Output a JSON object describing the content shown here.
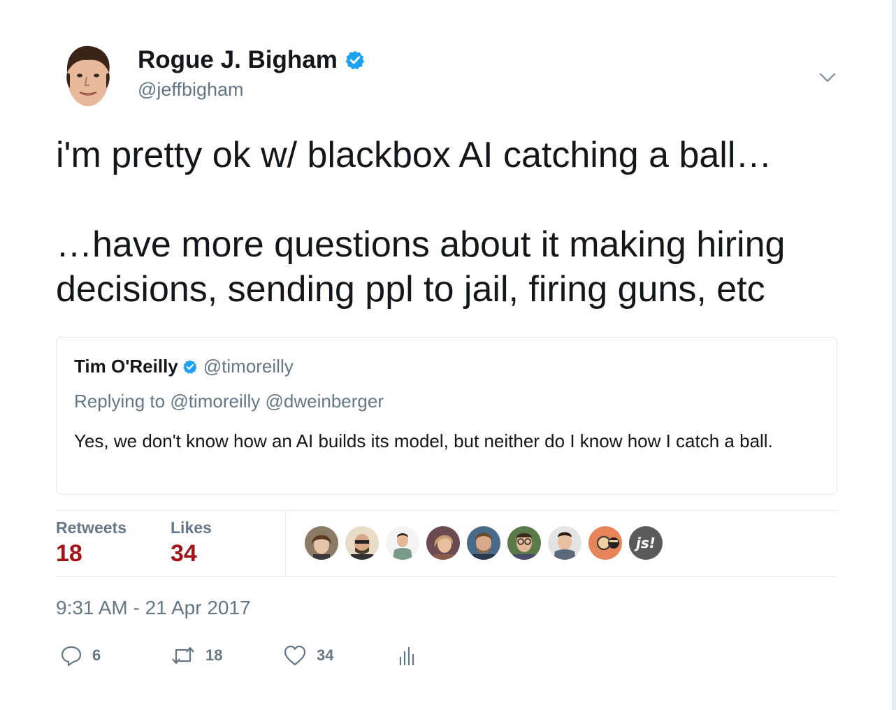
{
  "author": {
    "name": "Rogue J. Bigham",
    "handle": "@jeffbigham"
  },
  "tweet": {
    "line1": "i'm pretty ok w/ blackbox AI catching a ball…",
    "line2": "…have more questions about it making hiring",
    "line3": "decisions, sending ppl to jail, firing guns, etc"
  },
  "quoted": {
    "name": "Tim O'Reilly",
    "handle": "@timoreilly",
    "reply_prefix": "Replying to",
    "reply_to": "@timoreilly @dweinberger",
    "text": "Yes, we don't know how an AI builds its model, but neither do I know how I catch a ball."
  },
  "stats": {
    "retweets_label": "Retweets",
    "retweets_value": "18",
    "likes_label": "Likes",
    "likes_value": "34"
  },
  "liker_avatars": [
    {
      "name": "liker-1",
      "bg": "#8a7a66"
    },
    {
      "name": "liker-2",
      "bg": "#c9a98a"
    },
    {
      "name": "liker-3",
      "bg": "#f2f2f2"
    },
    {
      "name": "liker-4",
      "bg": "#6b4a52"
    },
    {
      "name": "liker-5",
      "bg": "#4a6a8a"
    },
    {
      "name": "liker-6",
      "bg": "#5a7a4a"
    },
    {
      "name": "liker-7",
      "bg": "#e0e0e0"
    },
    {
      "name": "liker-8",
      "bg": "#e8845a"
    },
    {
      "name": "liker-9",
      "bg": "#5a5a5a",
      "text": "js!"
    }
  ],
  "timestamp": "9:31 AM - 21 Apr 2017",
  "actions": {
    "replies": "6",
    "retweets": "18",
    "likes": "34"
  },
  "colors": {
    "verified": "#1da1f2",
    "stat_value": "#a0141a",
    "muted": "#657786"
  },
  "icons": [
    "verified-badge-icon",
    "chevron-down-icon",
    "reply-icon",
    "retweet-icon",
    "heart-icon",
    "analytics-icon"
  ]
}
